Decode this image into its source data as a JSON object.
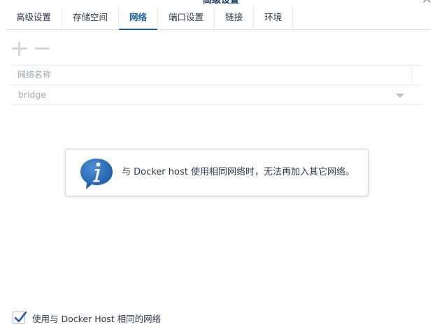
{
  "window": {
    "title": "高级设置",
    "close_glyph": "✕"
  },
  "tabs": [
    {
      "label": "高级设置",
      "active": false
    },
    {
      "label": "存储空间",
      "active": false
    },
    {
      "label": "网络",
      "active": true
    },
    {
      "label": "端口设置",
      "active": false
    },
    {
      "label": "链接",
      "active": false
    },
    {
      "label": "环境",
      "active": false
    }
  ],
  "toolbar": {
    "add_icon": "plus-icon",
    "remove_icon": "minus-icon"
  },
  "grid": {
    "header": "网络名称",
    "rows": [
      {
        "name": "bridge"
      }
    ]
  },
  "info": {
    "icon": "info-bubble-icon",
    "message": "与 Docker host 使用相同网络时，无法再加入其它网络。"
  },
  "use_host_network": {
    "checked": true,
    "label": "使用与 Docker Host 相同的网络"
  },
  "colors": {
    "accent": "#1e5ea8",
    "info_icon": "#1d5aa6",
    "check": "#1f5fa8"
  }
}
